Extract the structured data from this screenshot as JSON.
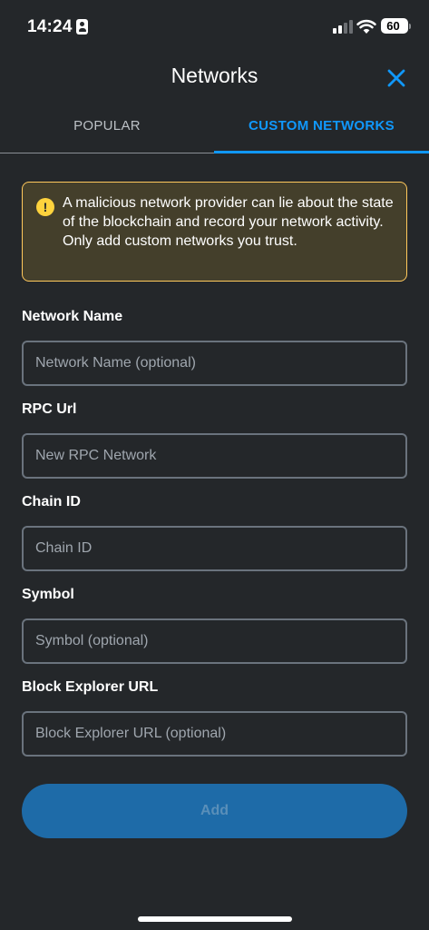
{
  "status_bar": {
    "time": "14:24",
    "battery_level": "60"
  },
  "header": {
    "title": "Networks",
    "close_icon": "close-icon"
  },
  "tabs": [
    {
      "label": "POPULAR",
      "active": false
    },
    {
      "label": "CUSTOM NETWORKS",
      "active": true
    }
  ],
  "warning": {
    "icon": "warning-icon",
    "text": "A malicious network provider can lie about the state of the blockchain and record your network activity. Only add custom networks you trust."
  },
  "form": {
    "network_name": {
      "label": "Network Name",
      "value": "",
      "placeholder": "Network Name (optional)"
    },
    "rpc_url": {
      "label": "RPC Url",
      "value": "",
      "placeholder": "New RPC Network"
    },
    "chain_id": {
      "label": "Chain ID",
      "value": "",
      "placeholder": "Chain ID"
    },
    "symbol": {
      "label": "Symbol",
      "value": "",
      "placeholder": "Symbol (optional)"
    },
    "block_explorer_url": {
      "label": "Block Explorer URL",
      "value": "",
      "placeholder": "Block Explorer URL (optional)"
    }
  },
  "add_button": {
    "label": "Add",
    "enabled": false
  },
  "colors": {
    "background": "#24272a",
    "accent": "#1098fc",
    "warning_border": "#ffc95c",
    "warning_background": "#443f2b",
    "button_background": "#1e6ba8"
  }
}
